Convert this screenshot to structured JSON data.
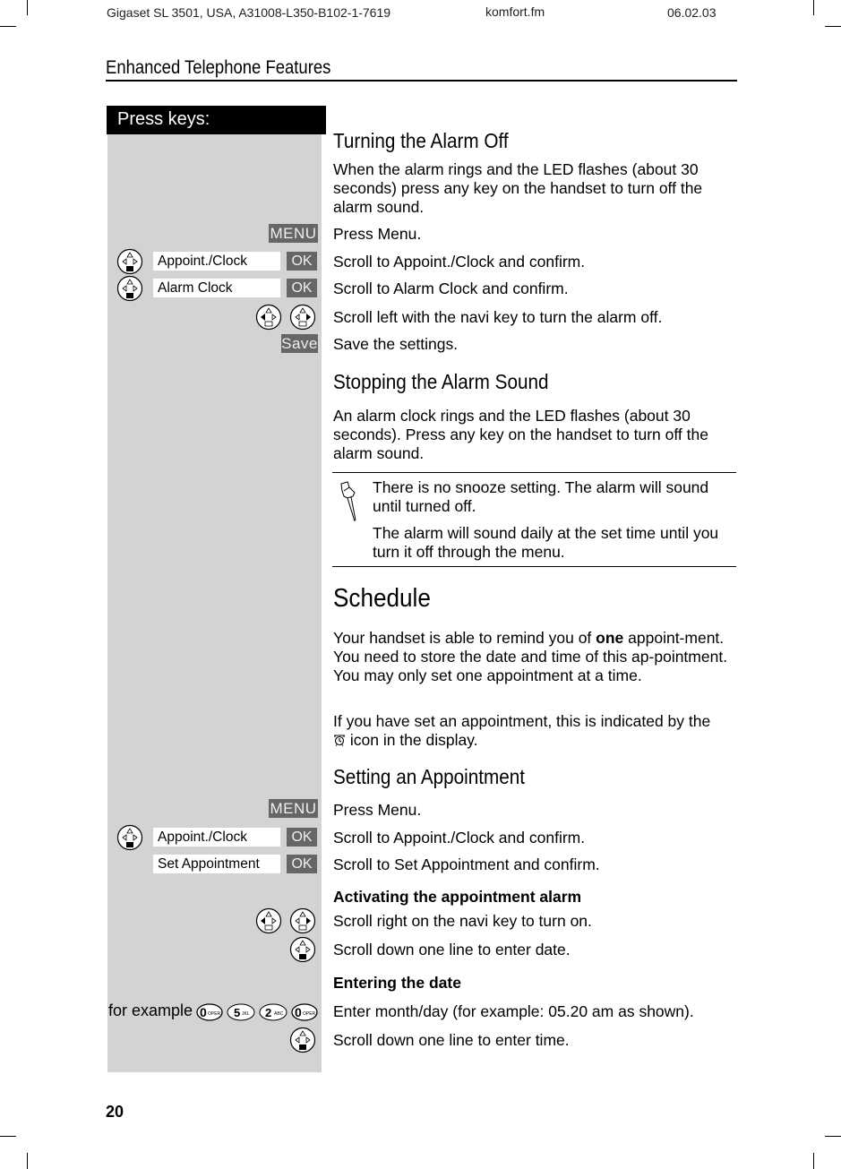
{
  "page_header": {
    "doc_id": "Gigaset SL 3501, USA, A31008-L350-B102-1-7619",
    "file": "komfort.fm",
    "date": "06.02.03"
  },
  "section_title": "Enhanced Telephone Features",
  "keys_column_header": "Press keys:",
  "page_number": "20",
  "turning_alarm_off": {
    "title": "Turning the Alarm Off",
    "intro": "When the alarm rings and the LED flashes (about 30 seconds) press any key on the handset to turn off the alarm sound.",
    "steps": [
      {
        "keys": "MENU",
        "text": "Press Menu."
      },
      {
        "menu_item": "Appoint./Clock",
        "ok": "OK",
        "text": "Scroll to Appoint./Clock and confirm."
      },
      {
        "menu_item": "Alarm Clock",
        "ok": "OK",
        "text": "Scroll to Alarm Clock and confirm."
      },
      {
        "keys": "navi-left navi-right",
        "text": "Scroll left with the navi key to turn the alarm off."
      },
      {
        "keys": "Save",
        "text": "Save the settings."
      }
    ]
  },
  "stopping_alarm": {
    "title": "Stopping the Alarm Sound",
    "body": "An alarm clock rings and the LED flashes (about 30 seconds). Press any key on the handset to turn off the alarm sound.",
    "note_1": "There is no snooze setting. The alarm will sound until turned off.",
    "note_2": "The alarm will sound daily at the set time until you turn it off through the menu."
  },
  "schedule": {
    "title": "Schedule",
    "para1_before": "Your handset is able to remind you of ",
    "para1_bold": "one",
    "para1_after": " appoint-ment. You need to store the date and time of this ap-pointment. You may only set one appointment at a time.",
    "para2_before": "If you have set an appointment, this is indicated by the",
    "para2_after": " icon in the display."
  },
  "setting_appointment": {
    "title": "Setting an Appointment",
    "steps": [
      {
        "keys": "MENU",
        "text": "Press Menu."
      },
      {
        "menu_item": "Appoint./Clock",
        "ok": "OK",
        "text": "Scroll to Appoint./Clock and confirm."
      },
      {
        "menu_item": "Set Appointment",
        "ok": "OK",
        "text": "Scroll to Set Appointment and confirm."
      }
    ],
    "activating_heading": "Activating the appointment alarm",
    "activating_steps": [
      {
        "keys": "navi-left navi-right",
        "text": "Scroll right on the navi key to turn on."
      },
      {
        "keys": "navi-down",
        "text": "Scroll down one line to enter date."
      }
    ],
    "entering_date_heading": "Entering the date",
    "entering_date_steps": [
      {
        "prefix": "for example",
        "digit_keys": [
          {
            "digit": "0",
            "letters": "OPER"
          },
          {
            "digit": "5",
            "letters": "JKL"
          },
          {
            "digit": "2",
            "letters": "ABC"
          },
          {
            "digit": "0",
            "letters": "OPER"
          }
        ],
        "text_before": "Enter ",
        "text_mono": "month/day",
        "text_after": " (for example: 05.20 am as shown)."
      },
      {
        "keys": "navi-down",
        "text": "Scroll down one line to enter time."
      }
    ]
  }
}
